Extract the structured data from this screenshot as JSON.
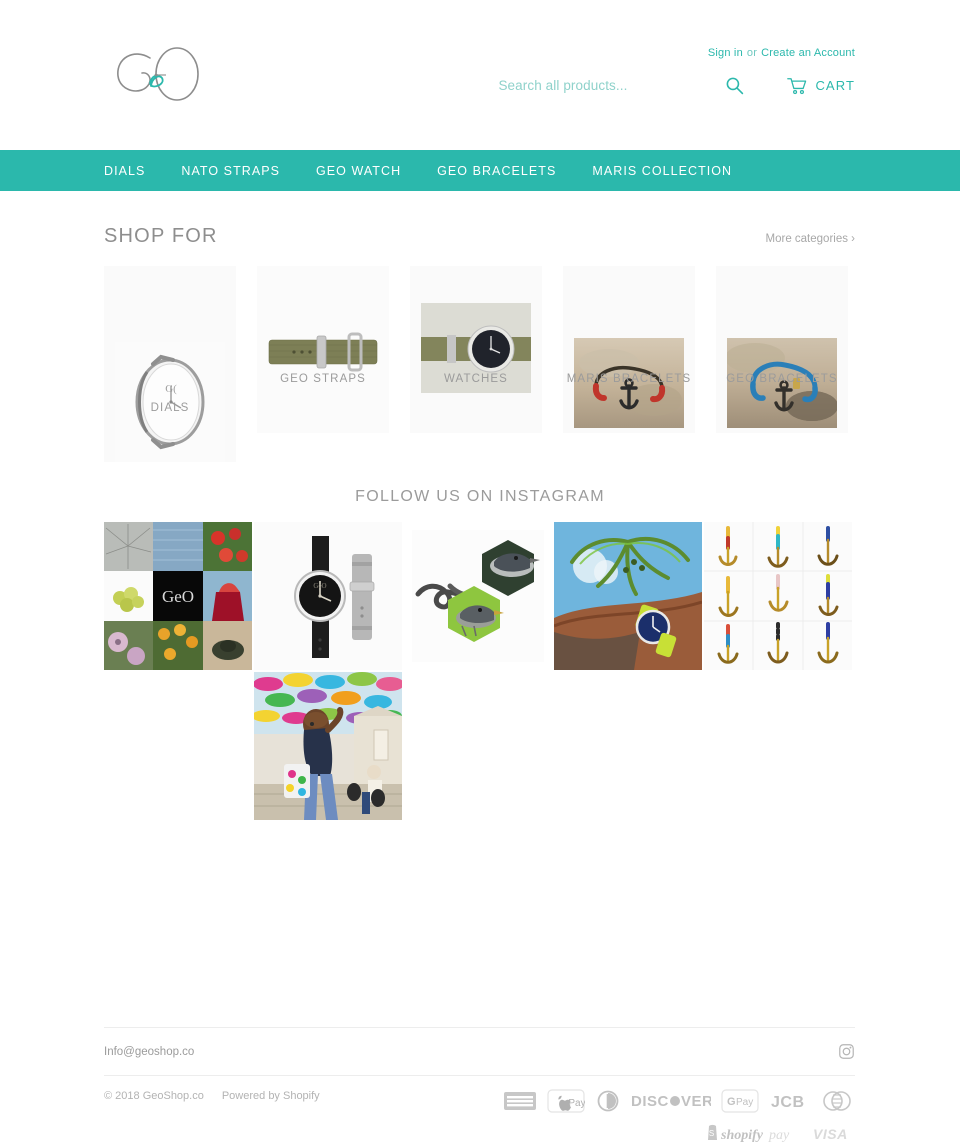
{
  "header": {
    "logo_text": "GeO",
    "logo_alt": "geo-handwritten-logo",
    "signin_label": "Sign in",
    "or_label": "or",
    "create_account_label": "Create an Account",
    "search_placeholder": "Search all products...",
    "search_value": "",
    "search_icon": "search-icon",
    "cart_label": "CART",
    "cart_icon": "shopping-cart-icon"
  },
  "nav": {
    "items": [
      {
        "label": "DIALS"
      },
      {
        "label": "NATO STRAPS"
      },
      {
        "label": "GEO WATCH"
      },
      {
        "label": "GEO BRACELETS"
      },
      {
        "label": "MARIS COLLECTION"
      }
    ]
  },
  "shop_for": {
    "title": "SHOP FOR",
    "more_label": "More categories ›",
    "categories": [
      {
        "label": "DIALS",
        "image": "white-watch-dial-photo"
      },
      {
        "label": "GEO STRAPS",
        "image": "olive-nato-strap-photo"
      },
      {
        "label": "WATCHES",
        "image": "olive-strap-black-dial-watch-photo"
      },
      {
        "label": "MARIS BRACELETS",
        "image": "red-anchor-bracelet-on-sand-photo"
      },
      {
        "label": "GEO BRACELETS",
        "image": "blue-anchor-bracelet-on-sand-photo"
      }
    ]
  },
  "instagram": {
    "title": "FOLLOW US ON INSTAGRAM",
    "posts": [
      {
        "alt": "nine-photo-collage-with-geo-logo"
      },
      {
        "alt": "two-watches-black-and-grey-straps"
      },
      {
        "alt": "hexagon-bird-photos-and-knot"
      },
      {
        "alt": "watch-on-wrist-under-palm-tree"
      },
      {
        "alt": "anchor-bracelets-grid"
      },
      {
        "alt": "woman-under-colorful-umbrellas"
      }
    ]
  },
  "footer": {
    "email": "Info@geoshop.co",
    "instagram_icon": "instagram-icon",
    "copyright": "© 2018 GeoShop.co",
    "powered_by": "Powered by Shopify",
    "payments": [
      {
        "name": "american-express"
      },
      {
        "name": "apple-pay"
      },
      {
        "name": "diners-club"
      },
      {
        "name": "discover"
      },
      {
        "name": "google-pay"
      },
      {
        "name": "jcb"
      },
      {
        "name": "mastercard"
      },
      {
        "name": "shopify-pay"
      },
      {
        "name": "visa"
      }
    ]
  },
  "colors": {
    "brand_teal": "#2bb8ac",
    "text_grey": "#9b9b9b",
    "card_bg": "#fafafa"
  }
}
